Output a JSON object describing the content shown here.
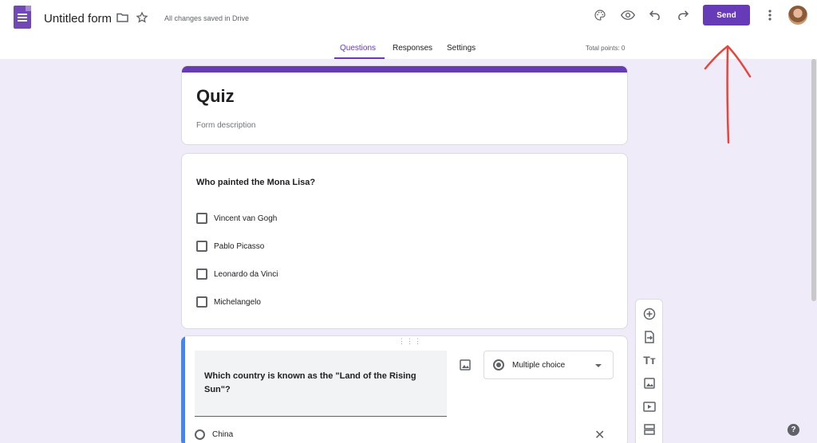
{
  "header": {
    "title": "Untitled form",
    "save_status": "All changes saved in Drive",
    "send_label": "Send",
    "icons": [
      "forms-logo-icon",
      "folder-icon",
      "star-icon",
      "palette-icon",
      "preview-eye-icon",
      "undo-icon",
      "redo-icon",
      "more-vert-icon",
      "avatar"
    ]
  },
  "tabs": {
    "questions": "Questions",
    "responses": "Responses",
    "settings": "Settings",
    "total_points": "Total points: 0"
  },
  "form": {
    "title": "Quiz",
    "description_placeholder": "Form description"
  },
  "question1": {
    "text": "Who painted the Mona Lisa?",
    "options": [
      "Vincent van Gogh",
      "Pablo Picasso",
      "Leonardo da Vinci",
      "Michelangelo"
    ]
  },
  "question2": {
    "text": "Which country is known as the \"Land of the Rising Sun\"?",
    "type": "Multiple choice",
    "options": [
      "China"
    ]
  },
  "toolbar": {
    "items": [
      "add-question-icon",
      "import-questions-icon",
      "add-title-icon",
      "add-image-icon",
      "add-video-icon",
      "add-section-icon"
    ]
  },
  "help_label": "?",
  "colors": {
    "accent": "#673ab7",
    "background": "#f0ebf8",
    "active_question": "#4285f4",
    "annotation": "#e8453c"
  }
}
